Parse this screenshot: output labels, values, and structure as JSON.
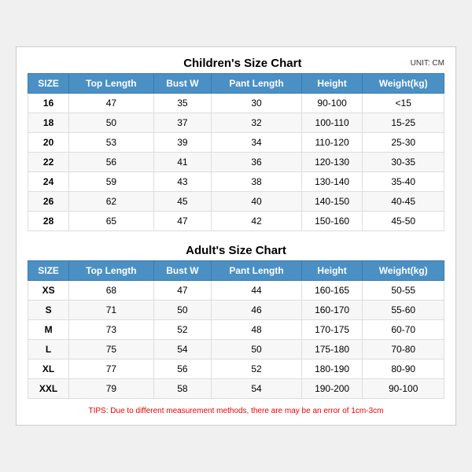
{
  "children": {
    "title": "Children's Size Chart",
    "unit": "UNIT: CM",
    "headers": [
      "SIZE",
      "Top Length",
      "Bust W",
      "Pant Length",
      "Height",
      "Weight(kg)"
    ],
    "rows": [
      [
        "16",
        "47",
        "35",
        "30",
        "90-100",
        "<15"
      ],
      [
        "18",
        "50",
        "37",
        "32",
        "100-110",
        "15-25"
      ],
      [
        "20",
        "53",
        "39",
        "34",
        "110-120",
        "25-30"
      ],
      [
        "22",
        "56",
        "41",
        "36",
        "120-130",
        "30-35"
      ],
      [
        "24",
        "59",
        "43",
        "38",
        "130-140",
        "35-40"
      ],
      [
        "26",
        "62",
        "45",
        "40",
        "140-150",
        "40-45"
      ],
      [
        "28",
        "65",
        "47",
        "42",
        "150-160",
        "45-50"
      ]
    ]
  },
  "adults": {
    "title": "Adult's Size Chart",
    "headers": [
      "SIZE",
      "Top Length",
      "Bust W",
      "Pant Length",
      "Height",
      "Weight(kg)"
    ],
    "rows": [
      [
        "XS",
        "68",
        "47",
        "44",
        "160-165",
        "50-55"
      ],
      [
        "S",
        "71",
        "50",
        "46",
        "160-170",
        "55-60"
      ],
      [
        "M",
        "73",
        "52",
        "48",
        "170-175",
        "60-70"
      ],
      [
        "L",
        "75",
        "54",
        "50",
        "175-180",
        "70-80"
      ],
      [
        "XL",
        "77",
        "56",
        "52",
        "180-190",
        "80-90"
      ],
      [
        "XXL",
        "79",
        "58",
        "54",
        "190-200",
        "90-100"
      ]
    ]
  },
  "tips": "TIPS: Due to different measurement methods, there are may be an error of 1cm-3cm"
}
